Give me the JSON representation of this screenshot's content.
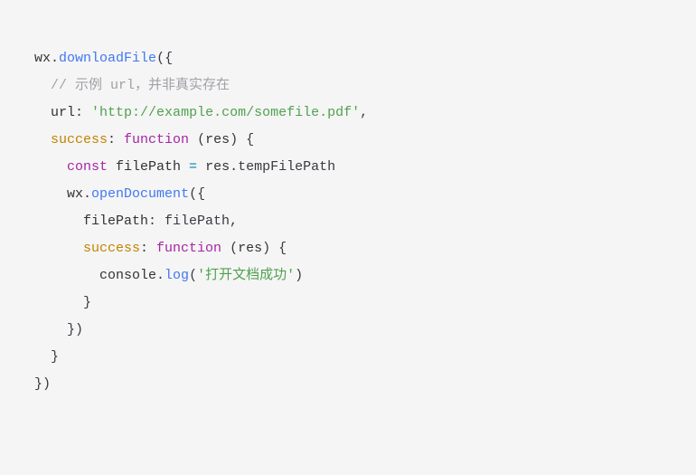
{
  "code": {
    "l1": {
      "wx": "wx",
      "dot": ".",
      "method": "downloadFile",
      "open": "({"
    },
    "l2": {
      "indent": "  ",
      "comment": "// 示例 url，并非真实存在"
    },
    "l3": {
      "indent": "  ",
      "key": "url",
      "colon": ": ",
      "value": "'http://example.com/somefile.pdf'",
      "comma": ","
    },
    "l4": {
      "indent": "  ",
      "key": "success",
      "colon": ": ",
      "fn": "function ",
      "args": "(res) {",
      "argname": "res"
    },
    "l5": {
      "indent": "    ",
      "const": "const ",
      "name": "filePath ",
      "eq": "= ",
      "rhs_res": "res",
      "rhs_dot": ".tempFilePath"
    },
    "l6": {
      "indent": "    ",
      "wx": "wx",
      "dot": ".",
      "method": "openDocument",
      "open": "({"
    },
    "l7": {
      "indent": "      ",
      "key": "filePath",
      "colon": ": filePath,"
    },
    "l8": {
      "indent": "      ",
      "key": "success",
      "colon": ": ",
      "fn": "function ",
      "open": "(",
      "arg": "res",
      "close": ") {"
    },
    "l9": {
      "indent": "        ",
      "obj": "console",
      "dot": ".",
      "method": "log",
      "open": "(",
      "str": "'打开文档成功'",
      "close": ")"
    },
    "l10": {
      "indent": "      ",
      "brace": "}"
    },
    "l11": {
      "indent": "    ",
      "close": "})"
    },
    "l12": {
      "indent": "  ",
      "brace": "}"
    },
    "l13": {
      "close": "})"
    }
  }
}
